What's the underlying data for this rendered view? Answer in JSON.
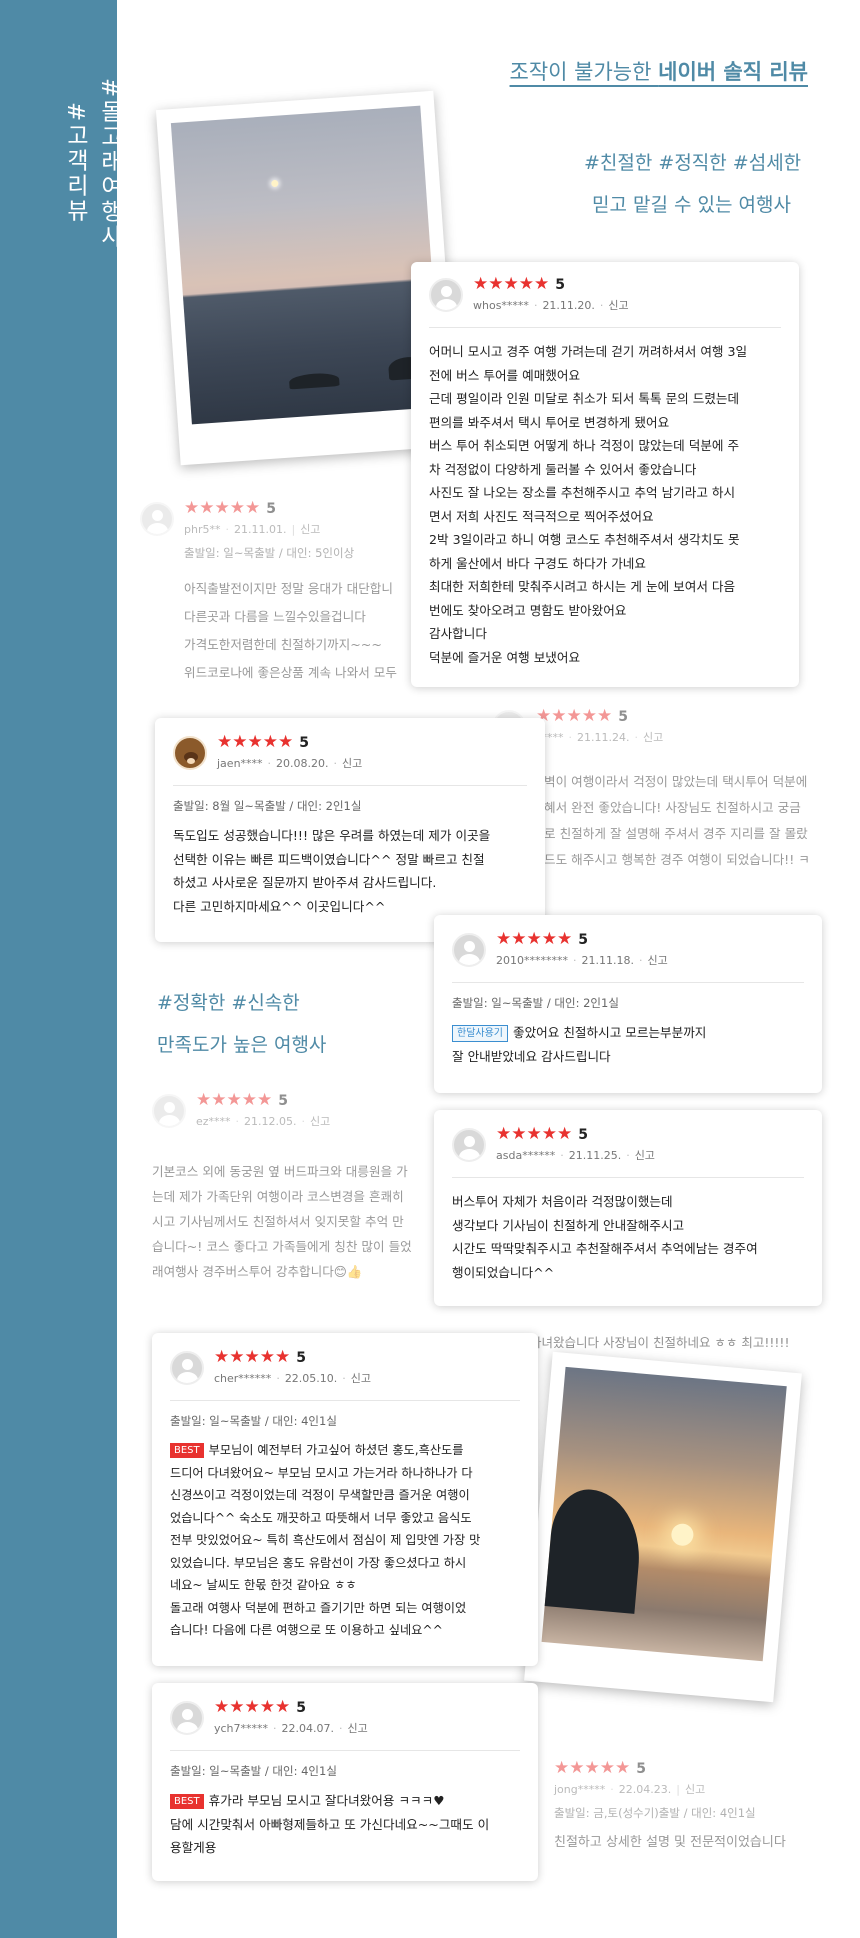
{
  "sidebar": {
    "tags": [
      "#돌고래여행사",
      "#고객리뷰"
    ]
  },
  "header": {
    "prefix": "조작이 불가능한 ",
    "highlight": "네이버 솔직 리뷰"
  },
  "taglines": {
    "t1_line1": "#친절한 #정직한 #섬세한",
    "t1_line2": "믿고 맡길 수 있는 여행사",
    "t2_line1": "#정확한 #신속한",
    "t2_line2": "만족도가 높은 여행사"
  },
  "colors": {
    "accent": "#4f8aa6",
    "star": "#e8322f"
  },
  "reviews": {
    "whos": {
      "stars": "★★★★★",
      "score": "5",
      "user": "whos*****",
      "date": "21.11.20.",
      "report": "신고",
      "lines": [
        "어머니 모시고 경주 여행 가려는데 걷기 꺼려하셔서 여행 3일",
        "전에 버스 투어를 예매했어요",
        "근데 평일이라 인원 미달로 취소가 되서 톡톡 문의 드렸는데",
        "편의를 봐주셔서 택시 투어로 변경하게 됐어요",
        "버스 투어 취소되면 어떻게 하나 걱정이 많았는데 덕분에 주",
        "차 걱정없이 다양하게 둘러볼 수 있어서 좋았습니다",
        "사진도 잘 나오는 장소를 추천해주시고 추억 남기라고 하시",
        "면서 저희 사진도 적극적으로 찍어주셨어요",
        "2박 3일이라고 하니 여행 코스도 추천해주셔서 생각치도 못",
        "하게 울산에서 바다 구경도 하다가 가네요",
        "최대한 저희한테 맞춰주시려고 하시는 게 눈에 보여서 다음",
        "번에도 찾아오려고 명함도 받아왔어요",
        "감사합니다",
        "덕분에 즐거운 여행 보냈어요"
      ]
    },
    "phr5": {
      "stars": "★★★★★",
      "score": "5",
      "user": "phr5**",
      "date": "21.11.01.",
      "report": "신고",
      "trip": "출발일: 일~목출발 / 대인: 5인이상",
      "lines": [
        "아직출발전이지만 정말 응대가 대단합니",
        "다른곳과 다름을 느낄수있을겁니다",
        "가격도한저렴한데 친절하기까지~~~",
        "위드코로나에 좋은상품 계속 나와서 모두"
      ]
    },
    "jaen": {
      "stars": "★★★★★",
      "score": "5",
      "user": "jaen****",
      "date": "20.08.20.",
      "report": "신고",
      "trip": "출발일: 8월 일~목출발 / 대인: 2인1실",
      "lines": [
        "독도입도 성공했습니다!!! 많은 우려를 하였는데 제가 이곳을",
        "선택한 이유는 빠른 피드백이였습니다^^ 정말 빠르고 친절",
        "하셨고 사사로운 질문까지 받아주셔 감사드립니다.",
        "다른 고민하지마세요^^ 이곳입니다^^"
      ]
    },
    "hidden1": {
      "stars": "★★★★★",
      "score": "5",
      "user": "*****",
      "date": "21.11.24.",
      "report": "신고",
      "lines": [
        "벽이 여행이라서 걱정이 많았는데 택시투어 덕분에",
        "혜서 완전 좋았습니다! 사장님도 친절하시고 궁금",
        "로 친절하게 잘 설명해 주셔서 경주 지리를 잘 몰랐",
        "드도 해주시고 행복한 경주 여행이 되었습니다!! ㅋ"
      ]
    },
    "r2010": {
      "stars": "★★★★★",
      "score": "5",
      "user": "2010********",
      "date": "21.11.18.",
      "report": "신고",
      "trip": "출발일: 일~목출발 / 대인: 2인1실",
      "tag": "한달사용기",
      "lines": [
        "좋았어요 친절하시고 모르는부분까지",
        "잘 안내받았네요 감사드립니다"
      ]
    },
    "ez": {
      "stars": "★★★★★",
      "score": "5",
      "user": "ez****",
      "date": "21.12.05.",
      "report": "신고",
      "lines": [
        "기본코스 외에 동궁원 옆 버드파크와 대릉원을 가",
        "는데 제가 가족단위 여행이라 코스변경을 흔쾌히",
        "시고 기사님께서도 친절하셔서 잊지못할 추억 만",
        "습니다~! 코스 좋다고 가족들에게 칭찬 많이 들었",
        "래여행사 경주버스투어 강추합니다😊👍"
      ]
    },
    "asda": {
      "stars": "★★★★★",
      "score": "5",
      "user": "asda******",
      "date": "21.11.25.",
      "report": "신고",
      "lines": [
        "버스투어 자체가 처음이라 걱정많이했는데",
        "생각보다 기사님이 친절하게 안내잘해주시고",
        "시간도 딱딱맞춰주시고 추천잘해주셔서 추억에남는 경주여",
        "행이되었습니다^^"
      ]
    },
    "hidden2": {
      "text": "다녀왔습니다 사장님이 친절하네요 ㅎㅎ 최고!!!!!"
    },
    "cher": {
      "stars": "★★★★★",
      "score": "5",
      "user": "cher******",
      "date": "22.05.10.",
      "report": "신고",
      "trip": "출발일: 일~목출발 / 대인: 4인1실",
      "tag": "BEST",
      "lines": [
        "부모님이 예전부터 가고싶어 하셨던 홍도,흑산도를",
        "드디어 다녀왔어요~ 부모님 모시고 가는거라 하나하나가 다",
        "신경쓰이고 걱정이었는데 걱정이 무색할만큼 즐거운 여행이",
        "었습니다^^ 숙소도 깨끗하고 따뜻해서 너무 좋았고 음식도",
        "전부 맛있었어요~ 특히 흑산도에서 점심이 제 입맛엔 가장 맛",
        "있었습니다. 부모님은 홍도 유람선이 가장 좋으셨다고 하시",
        "네요~ 날씨도 한몫 한것 같아요 ㅎㅎ",
        "돌고래 여행사 덕분에 편하고 즐기기만 하면 되는 여행이었",
        "습니다! 다음에 다른 여행으로 또 이용하고 싶네요^^"
      ]
    },
    "ych7": {
      "stars": "★★★★★",
      "score": "5",
      "user": "ych7*****",
      "date": "22.04.07.",
      "report": "신고",
      "trip": "출발일: 일~목출발 / 대인: 4인1실",
      "tag": "BEST",
      "lines": [
        "휴가라 부모님 모시고 잘다녀왔어용 ㅋㅋㅋ♥",
        "담에 시간맞춰서 아빠형제들하고 또 가신다네요~~그때도 이",
        "용할게용"
      ]
    },
    "jong": {
      "stars": "★★★★★",
      "score": "5",
      "user": "jong*****",
      "date": "22.04.23.",
      "report": "신고",
      "trip": "출발일: 금,토(성수기)출발 / 대인: 4인1실",
      "lines": [
        "친절하고 상세한 설명 및 전문적이었습니다"
      ]
    }
  }
}
